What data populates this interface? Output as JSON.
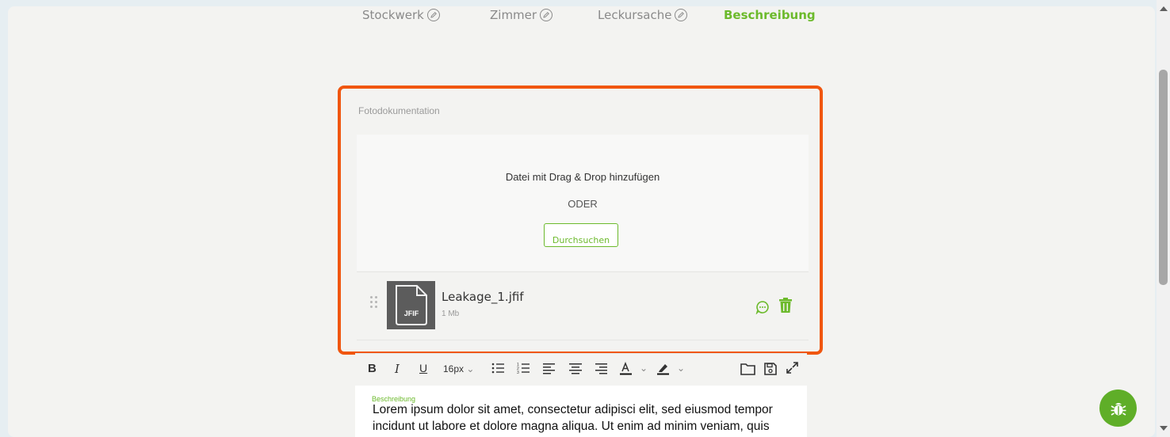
{
  "steps": [
    {
      "label": "Stockwerk",
      "editable": true
    },
    {
      "label": "Zimmer",
      "editable": true
    },
    {
      "label": "Leckursache",
      "editable": true
    },
    {
      "label": "Beschreibung",
      "active": true
    }
  ],
  "photo_section": {
    "label": "Fotodokumentation",
    "dropzone_title": "Datei mit Drag & Drop hinzufügen",
    "or_text": "ODER",
    "browse_label": "Durchsuchen"
  },
  "file": {
    "name": "Leakage_1.jfif",
    "size": "1 Mb",
    "type_badge": "JFIF"
  },
  "editor": {
    "font_size": "16px",
    "field_label": "Beschreibung",
    "text": "Lorem ipsum dolor sit amet, consectetur adipisci elit, sed eiusmod tempor incidunt ut labore et dolore magna aliqua. Ut enim ad minim veniam, quis"
  },
  "colors": {
    "accent": "#6cba2c",
    "highlight": "#f0560f",
    "bug_button": "#5fae28"
  },
  "icons": [
    "pencil-icon",
    "drag-handle-icon",
    "file-icon",
    "comment-icon",
    "trash-icon",
    "bold-icon",
    "italic-icon",
    "underline-icon",
    "bullet-list-icon",
    "numbered-list-icon",
    "align-left-icon",
    "align-center-icon",
    "align-right-icon",
    "text-color-icon",
    "highlight-icon",
    "folder-icon",
    "save-icon",
    "expand-icon",
    "bug-icon"
  ]
}
